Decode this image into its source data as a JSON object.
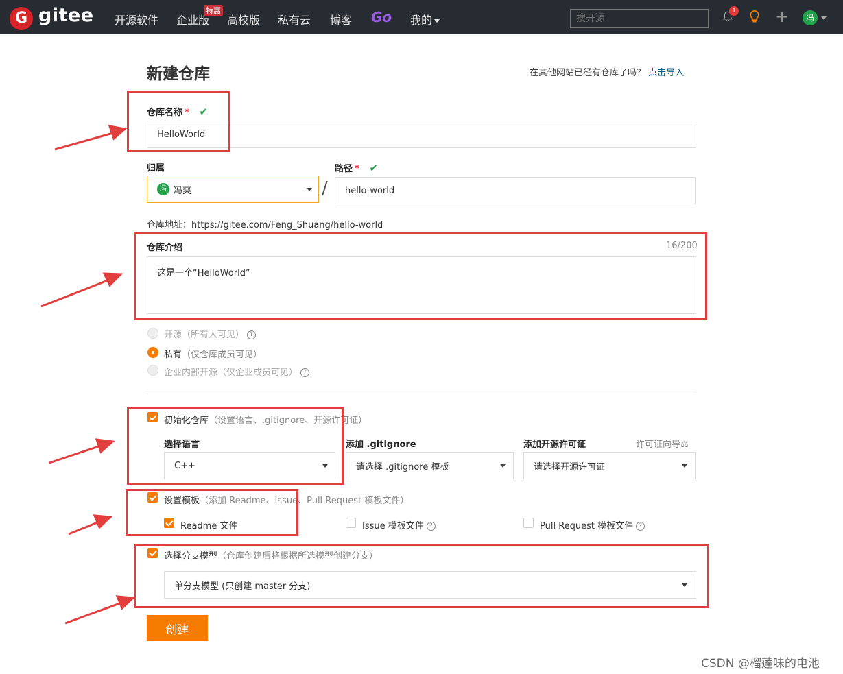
{
  "nav": {
    "logo_letter": "G",
    "logo_text": "gitee",
    "items": [
      "开源软件",
      "企业版",
      "高校版",
      "私有云",
      "博客"
    ],
    "promo_badge": "特惠",
    "go_label": "Go",
    "mine_label": "我的",
    "search_placeholder": "搜开源",
    "notification_count": "1",
    "avatar_char": "冯"
  },
  "form": {
    "title": "新建仓库",
    "import_prompt": "在其他网站已经有仓库了吗？",
    "import_link": "点击导入",
    "repo_name_label": "仓库名称",
    "required_mark": "*",
    "check_mark": "✔",
    "repo_name_value": "HelloWorld",
    "owner_label": "归属",
    "owner_avatar": "冯",
    "owner_value": "冯爽",
    "slash": "/",
    "path_label": "路径",
    "path_value": "hello-world",
    "repo_url_prefix": "仓库地址：",
    "repo_url": "https://gitee.com/Feng_Shuang/hello-world",
    "desc_label": "仓库介绍",
    "desc_counter": "16/200",
    "desc_value": "这是一个“HelloWorld”",
    "visibility": [
      {
        "label": "开源",
        "hint": "（所有人可见）",
        "selected": false,
        "disabled": true
      },
      {
        "label": "私有",
        "hint": "（仅仓库成员可见）",
        "selected": true,
        "disabled": false
      },
      {
        "label": "企业内部开源",
        "hint": "（仅企业成员可见）",
        "selected": false,
        "disabled": true
      }
    ],
    "init_label": "初始化仓库",
    "init_hint": "（设置语言、.gitignore、开源许可证）",
    "language_label": "选择语言",
    "language_value": "C++",
    "gitignore_label": "添加 .gitignore",
    "gitignore_value": "请选择 .gitignore 模板",
    "license_label": "添加开源许可证",
    "license_guide": "许可证向导",
    "license_guide_icon": "⚖",
    "license_value": "请选择开源许可证",
    "template_label": "设置模板",
    "template_hint": "（添加 Readme、Issue、Pull Request 模板文件）",
    "readme_label": "Readme 文件",
    "issue_label": "Issue 模板文件",
    "pr_label": "Pull Request 模板文件",
    "branch_label": "选择分支模型",
    "branch_hint": "（仓库创建后将根据所选模型创建分支）",
    "branch_value": "单分支模型 (只创建 master 分支)",
    "create_button": "创建"
  },
  "watermark": "CSDN @榴莲味的电池",
  "colors": {
    "nav_bg": "#272c33",
    "brand": "#d9242a",
    "accent": "#f57c00",
    "success": "#21a34a",
    "annotation": "#e23e3e"
  }
}
